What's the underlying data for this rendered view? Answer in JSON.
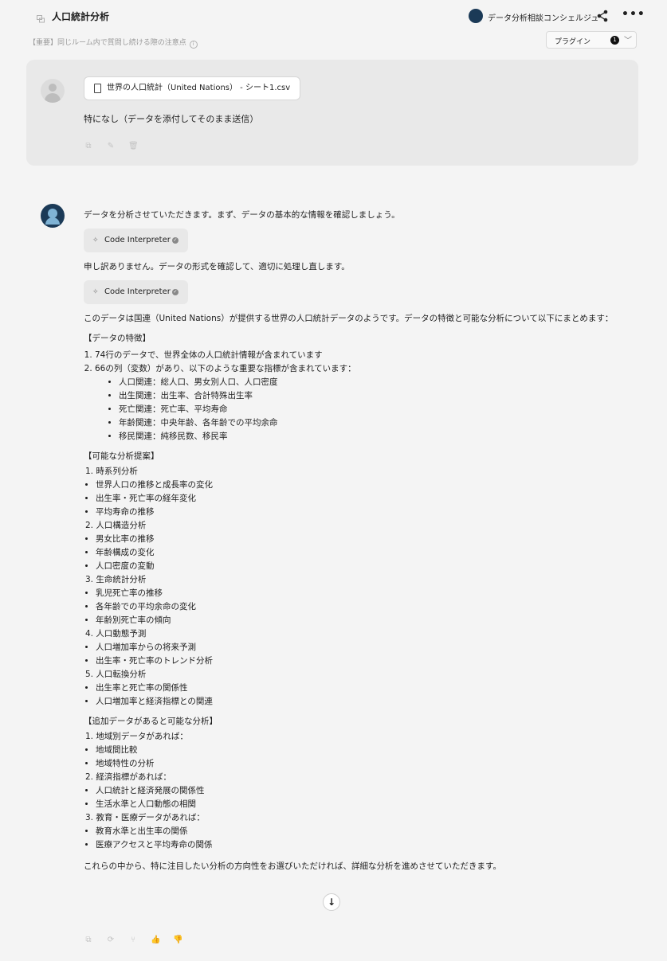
{
  "header": {
    "room_title": "人口統計分析",
    "assistant_name": "データ分析相談コンシェルジュ",
    "notice": "【重要】同じルーム内で質問し続ける際の注意点",
    "plugin_label": "プラグイン",
    "plugin_count": "1"
  },
  "user_message": {
    "file_name": "世界の人口統計（United Nations） - シート1.csv",
    "text": "特になし（データを添付してそのまま送信）"
  },
  "response": {
    "intro": "データを分析させていただきます。まず、データの基本的な情報を確認しましょう。",
    "tool_label": "Code Interpreter",
    "retry": "申し訳ありません。データの形式を確認して、適切に処理し直します。",
    "summary": "このデータは国連（United Nations）が提供する世界の人口統計データのようです。データの特徴と可能な分析について以下にまとめます：",
    "features_heading": "【データの特徴】",
    "features": [
      {
        "text": "74行のデータで、世界全体の人口統計情報が含まれています",
        "subs": []
      },
      {
        "text": "66の列（変数）があり、以下のような重要な指標が含まれています：",
        "subs": [
          "人口関連：総人口、男女別人口、人口密度",
          "出生関連：出生率、合計特殊出生率",
          "死亡関連：死亡率、平均寿命",
          "年齢関連：中央年齢、各年齢での平均余命",
          "移民関連：純移民数、移民率"
        ]
      }
    ],
    "proposals_heading": "【可能な分析提案】",
    "proposals": [
      {
        "n": "1.",
        "title": "時系列分析",
        "items": [
          "世界人口の推移と成長率の変化",
          "出生率・死亡率の経年変化",
          "平均寿命の推移"
        ]
      },
      {
        "n": "2.",
        "title": "人口構造分析",
        "items": [
          "男女比率の推移",
          "年齢構成の変化",
          "人口密度の変動"
        ]
      },
      {
        "n": "3.",
        "title": "生命統計分析",
        "items": [
          "乳児死亡率の推移",
          "各年齢での平均余命の変化",
          "年齢別死亡率の傾向"
        ]
      },
      {
        "n": "4.",
        "title": "人口動態予測",
        "items": [
          "人口増加率からの将来予測",
          "出生率・死亡率のトレンド分析"
        ]
      },
      {
        "n": "5.",
        "title": "人口転換分析",
        "items": [
          "出生率と死亡率の関係性",
          "人口増加率と経済指標との関連"
        ]
      }
    ],
    "additional_heading": "【追加データがあると可能な分析】",
    "additional": [
      {
        "n": "1.",
        "title": "地域別データがあれば：",
        "items": [
          "地域間比較",
          "地域特性の分析"
        ]
      },
      {
        "n": "2.",
        "title": "経済指標があれば：",
        "items": [
          "人口統計と経済発展の関係性",
          "生活水準と人口動態の相関"
        ]
      },
      {
        "n": "3.",
        "title": "教育・医療データがあれば：",
        "items": [
          "教育水準と出生率の関係",
          "医療アクセスと平均寿命の関係"
        ]
      }
    ],
    "closing": "これらの中から、特に注目したい分析の方向性をお選びいただければ、詳細な分析を進めさせていただきます。"
  }
}
